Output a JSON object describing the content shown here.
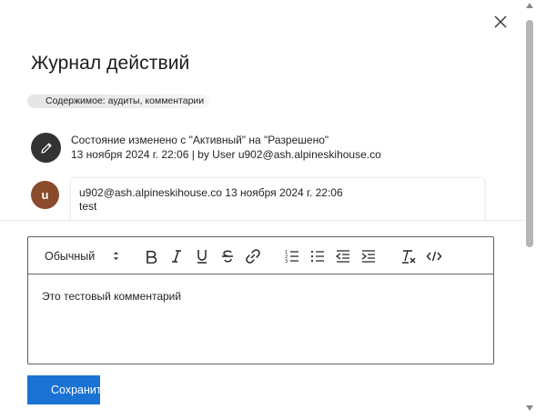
{
  "dialog": {
    "title": "Журнал действий",
    "close_icon": "close-icon"
  },
  "filter": {
    "label": "Содержимое: аудиты, комментарии"
  },
  "timeline": {
    "audit": {
      "icon": "pencil-icon",
      "line1": "Состояние изменено с \"Активный\" на \"Разрешено\"",
      "line2": "13 ноября 2024 г. 22:06 | by User u902@ash.alpineskihouse.co"
    },
    "comment": {
      "avatar_initial": "u",
      "header": "u902@ash.alpineskihouse.co 13 ноября 2024 г. 22:06",
      "text": "test"
    }
  },
  "editor": {
    "style_value": "Обычный",
    "toolbar_icons": [
      "bold-icon",
      "italic-icon",
      "underline-icon",
      "strikethrough-icon",
      "link-icon",
      "numbered-list-icon",
      "bulleted-list-icon",
      "decrease-indent-icon",
      "increase-indent-icon",
      "clear-formatting-icon",
      "code-icon"
    ],
    "content": "Это тестовый комментарий"
  },
  "actions": {
    "save_label": "Сохранить"
  },
  "colors": {
    "accent": "#1a73d4",
    "avatar_user": "#8a4a2c",
    "avatar_edit": "#333333"
  }
}
